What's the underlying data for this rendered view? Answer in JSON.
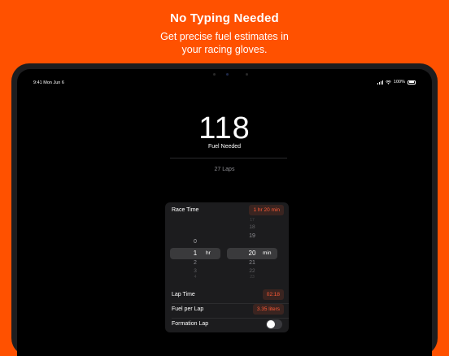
{
  "header": {
    "title": "No Typing Needed",
    "subtitle_line1": "Get precise fuel estimates in",
    "subtitle_line2": "your racing gloves."
  },
  "status_bar": {
    "time": "9:41  Mon Jun 6",
    "battery": "100%"
  },
  "result": {
    "fuel_value": "118",
    "fuel_label": "Fuel Needed",
    "laps": "27 Laps"
  },
  "race_time": {
    "label": "Race Time",
    "value": "1 hr 20 min"
  },
  "picker": {
    "hours": [
      "0",
      "1",
      "2",
      "3",
      "4"
    ],
    "hour_unit": "hr",
    "minutes": [
      "17",
      "18",
      "19",
      "20",
      "21",
      "22",
      "23"
    ],
    "minute_unit": "min"
  },
  "lap_time": {
    "label": "Lap Time",
    "value": "02:18"
  },
  "fuel_per_lap": {
    "label": "Fuel per Lap",
    "value": "3.35 liters"
  },
  "formation_lap": {
    "label": "Formation Lap",
    "enabled": false
  },
  "colors": {
    "background": "#FF5100",
    "accent": "#FF5A36",
    "screen": "#000000"
  }
}
